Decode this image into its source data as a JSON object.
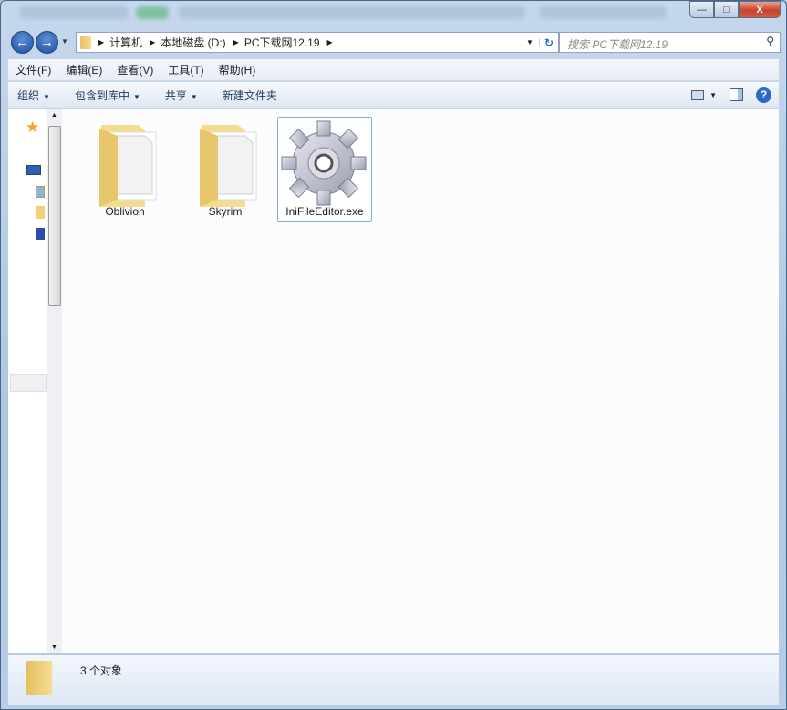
{
  "window": {
    "minimize": "—",
    "maximize": "□",
    "close": "X"
  },
  "address": {
    "crumbs": [
      "计算机",
      "本地磁盘 (D:)",
      "PC下载网12.19"
    ],
    "search_placeholder": "搜索 PC下载网12.19"
  },
  "menu": [
    "文件(F)",
    "编辑(E)",
    "查看(V)",
    "工具(T)",
    "帮助(H)"
  ],
  "toolbar": {
    "organize": "组织",
    "include_library": "包含到库中",
    "share": "共享",
    "new_folder": "新建文件夹"
  },
  "files": [
    {
      "name": "Oblivion",
      "type": "folder"
    },
    {
      "name": "Skyrim",
      "type": "folder"
    },
    {
      "name": "IniFileEditor.exe",
      "type": "exe",
      "selected": true
    }
  ],
  "status": {
    "count": "3 个对象"
  }
}
